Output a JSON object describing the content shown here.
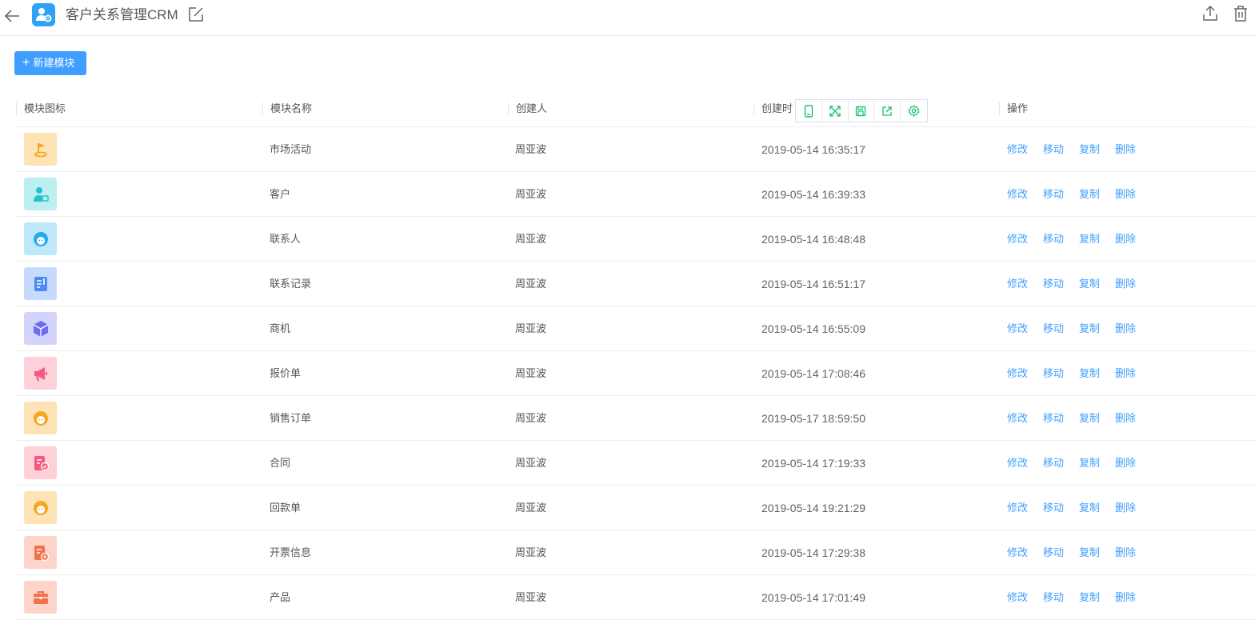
{
  "header": {
    "title": "客户关系管理CRM",
    "app_icon": "user-gear-icon",
    "accent": "#2fa2f5"
  },
  "toolbar": {
    "new_module_label": "新建模块"
  },
  "table": {
    "columns": [
      "模块图标",
      "模块名称",
      "创建人",
      "创建时",
      "操作"
    ],
    "rows": [
      {
        "icon": "flag-icon",
        "icon_bg": "#fde3b5",
        "icon_color": "#f5a623",
        "name": "市场活动",
        "creator": "周亚波",
        "created": "2019-05-14 16:35:17"
      },
      {
        "icon": "customer-icon",
        "icon_bg": "#bdeef0",
        "icon_color": "#20c3c9",
        "name": "客户",
        "creator": "周亚波",
        "created": "2019-05-14 16:39:33"
      },
      {
        "icon": "contact-icon",
        "icon_bg": "#bfe8fb",
        "icon_color": "#25a9f0",
        "name": "联系人",
        "creator": "周亚波",
        "created": "2019-05-14 16:48:48"
      },
      {
        "icon": "record-icon",
        "icon_bg": "#c5dafd",
        "icon_color": "#4a8af4",
        "name": "联系记录",
        "creator": "周亚波",
        "created": "2019-05-14 16:51:17"
      },
      {
        "icon": "box-icon",
        "icon_bg": "#d3d3fc",
        "icon_color": "#6c6cf0",
        "name": "商机",
        "creator": "周亚波",
        "created": "2019-05-14 16:55:09"
      },
      {
        "icon": "megaphone-icon",
        "icon_bg": "#fdd0da",
        "icon_color": "#f35a7e",
        "name": "报价单",
        "creator": "周亚波",
        "created": "2019-05-14 17:08:46"
      },
      {
        "icon": "person-orange-icon",
        "icon_bg": "#fde3b5",
        "icon_color": "#f5a623",
        "name": "销售订单",
        "creator": "周亚波",
        "created": "2019-05-17 18:59:50"
      },
      {
        "icon": "contract-icon",
        "icon_bg": "#fdd0da",
        "icon_color": "#f35a7e",
        "name": "合同",
        "creator": "周亚波",
        "created": "2019-05-14 17:19:33"
      },
      {
        "icon": "person-orange-icon",
        "icon_bg": "#fde3b5",
        "icon_color": "#f5a623",
        "name": "回款单",
        "creator": "周亚波",
        "created": "2019-05-14 19:21:29"
      },
      {
        "icon": "invoice-icon",
        "icon_bg": "#fdd5c8",
        "icon_color": "#f3714b",
        "name": "开票信息",
        "creator": "周亚波",
        "created": "2019-05-14 17:29:38"
      },
      {
        "icon": "briefcase-icon",
        "icon_bg": "#fdd5c8",
        "icon_color": "#f3714b",
        "name": "产品",
        "creator": "周亚波",
        "created": "2019-05-14 17:01:49"
      }
    ],
    "actions": [
      "修改",
      "移动",
      "复制",
      "删除"
    ]
  },
  "floating_toolbar": {
    "buttons": [
      "mobile-icon",
      "expand-icon",
      "save-icon",
      "share-icon",
      "settings-icon"
    ],
    "color": "#19be6b"
  }
}
